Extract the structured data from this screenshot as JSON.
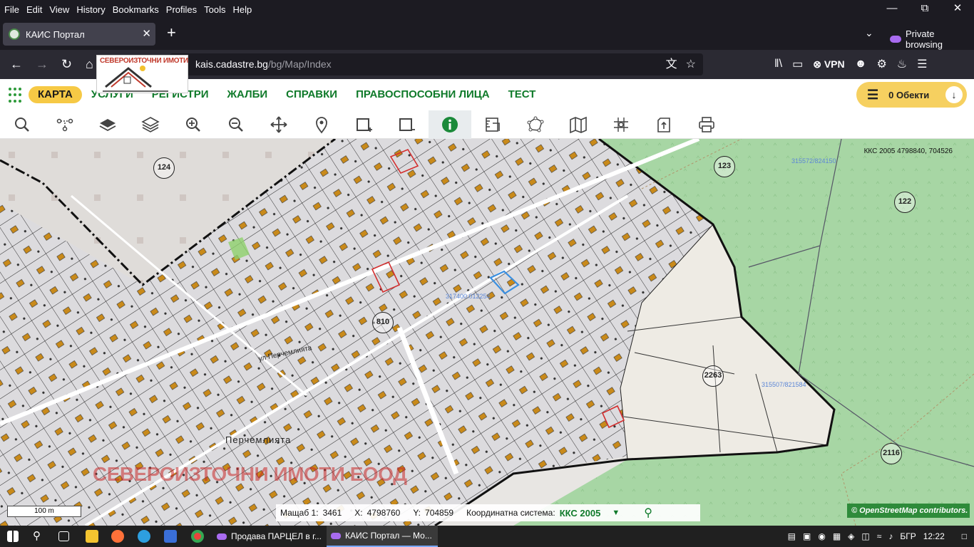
{
  "browser": {
    "menu": [
      "File",
      "Edit",
      "View",
      "History",
      "Bookmarks",
      "Profiles",
      "Tools",
      "Help"
    ],
    "tab_title": "КАИС Портал",
    "private_label": "Private browsing",
    "url_domain": "kais.cadastre.bg",
    "url_path": "/bg/Map/Index",
    "vpn_label": "VPN"
  },
  "logo": {
    "text": "СЕВЕРОИЗТОЧНИ ИМОТИ"
  },
  "site": {
    "nav": [
      "КАРТА",
      "УСЛУГИ",
      "РЕГИСТРИ",
      "ЖАЛБИ",
      "СПРАВКИ",
      "ПРАВОСПОСОБНИ ЛИЦА",
      "ТЕСТ"
    ],
    "objects_label": "0 Обекти"
  },
  "toolbar": {
    "tools": [
      "search-icon",
      "route-icon",
      "layer-icon",
      "layers-icon",
      "zoom-in-icon",
      "zoom-out-icon",
      "pan-icon",
      "pin-icon",
      "draw-rect-add-icon",
      "draw-rect-remove-icon",
      "info-icon",
      "measure-icon",
      "polygon-icon",
      "map-icon",
      "grid-icon",
      "export-icon",
      "print-icon"
    ],
    "active_tool": "info-icon"
  },
  "map": {
    "top_coords": "ККС 2005 4798840, 704526",
    "circle_labels": [
      "124",
      "123",
      "122",
      "810",
      "2263",
      "2116"
    ],
    "place_labels": [
      "Перчемлията",
      "ул Перчемлията"
    ],
    "blue_labels": [
      "315572/824150",
      "317400.012254",
      "315507/821584"
    ],
    "watermark": "СЕВЕРОИЗТОЧНИ ИМОТИ ЕООД",
    "scale_label": "100 m",
    "attribution": "© OpenStreetMap contributors."
  },
  "status": {
    "scale_label": "Мащаб 1:",
    "scale_value": "3461",
    "x_label": "X:",
    "x_value": "4798760",
    "y_label": "Y:",
    "y_value": "704859",
    "cs_label": "Координатна система:",
    "cs_value": "ККС 2005"
  },
  "taskbar": {
    "apps": [
      "Продава ПАРЦЕЛ в г...",
      "КАИС Портал — Мо..."
    ],
    "lang": "БГР",
    "time": "12:22"
  },
  "colors": {
    "accent_green": "#0f7a2a",
    "accent_yellow": "#f6c945",
    "forest": "#a5d4a3"
  }
}
